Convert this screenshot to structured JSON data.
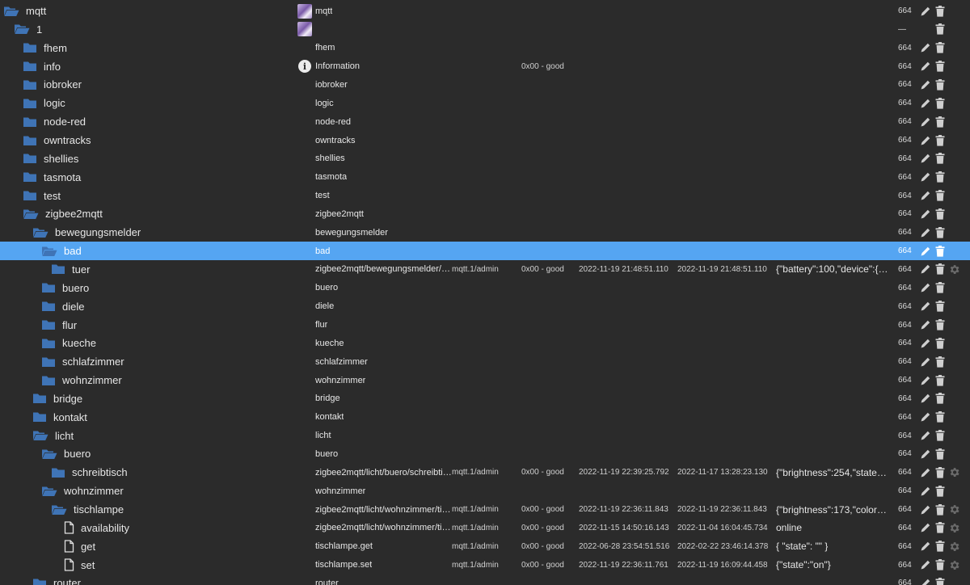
{
  "colors": {
    "background": "#2b2b2b",
    "selected_row": "#55a5f2",
    "folder_icon": "#3f74b6",
    "text": "#e6e6e6",
    "icon_gray": "#cfcfcf"
  },
  "rows": [
    {
      "name": "mqtt",
      "level": 0,
      "type": "folder-open",
      "display": "mqtt",
      "disp_icon": "logo",
      "acl": "664"
    },
    {
      "name": "1",
      "level": 1,
      "type": "folder-open",
      "display": "",
      "disp_icon": "logo",
      "acl": "—",
      "no_edit": true
    },
    {
      "name": "fhem",
      "level": 2,
      "type": "folder",
      "display": "fhem",
      "acl": "664"
    },
    {
      "name": "info",
      "level": 2,
      "type": "folder",
      "display": "Information",
      "disp_icon": "info",
      "quality": "0x00 - good",
      "acl": "664"
    },
    {
      "name": "iobroker",
      "level": 2,
      "type": "folder",
      "display": "iobroker",
      "acl": "664"
    },
    {
      "name": "logic",
      "level": 2,
      "type": "folder",
      "display": "logic",
      "acl": "664"
    },
    {
      "name": "node-red",
      "level": 2,
      "type": "folder",
      "display": "node-red",
      "acl": "664"
    },
    {
      "name": "owntracks",
      "level": 2,
      "type": "folder",
      "display": "owntracks",
      "acl": "664"
    },
    {
      "name": "shellies",
      "level": 2,
      "type": "folder",
      "display": "shellies",
      "acl": "664"
    },
    {
      "name": "tasmota",
      "level": 2,
      "type": "folder",
      "display": "tasmota",
      "acl": "664"
    },
    {
      "name": "test",
      "level": 2,
      "type": "folder",
      "display": "test",
      "acl": "664"
    },
    {
      "name": "zigbee2mqtt",
      "level": 2,
      "type": "folder-open",
      "display": "zigbee2mqtt",
      "acl": "664"
    },
    {
      "name": "bewegungsmelder",
      "level": 3,
      "type": "folder-open",
      "display": "bewegungsmelder",
      "acl": "664"
    },
    {
      "name": "bad",
      "level": 4,
      "type": "folder-open",
      "display": "bad",
      "acl": "664",
      "selected": true
    },
    {
      "name": "tuer",
      "level": 5,
      "type": "folder",
      "display": "zigbee2mqtt/bewegungsmelder/ba...",
      "from": "mqtt.1/admin",
      "quality": "0x00 - good",
      "ts": "2022-11-19 21:48:51.110",
      "lc": "2022-11-19 21:48:51.110",
      "value": "{\"battery\":100,\"device\":{\"a...",
      "acl": "664",
      "gear": true
    },
    {
      "name": "buero",
      "level": 4,
      "type": "folder",
      "display": "buero",
      "acl": "664"
    },
    {
      "name": "diele",
      "level": 4,
      "type": "folder",
      "display": "diele",
      "acl": "664"
    },
    {
      "name": "flur",
      "level": 4,
      "type": "folder",
      "display": "flur",
      "acl": "664"
    },
    {
      "name": "kueche",
      "level": 4,
      "type": "folder",
      "display": "kueche",
      "acl": "664"
    },
    {
      "name": "schlafzimmer",
      "level": 4,
      "type": "folder",
      "display": "schlafzimmer",
      "acl": "664"
    },
    {
      "name": "wohnzimmer",
      "level": 4,
      "type": "folder",
      "display": "wohnzimmer",
      "acl": "664"
    },
    {
      "name": "bridge",
      "level": 3,
      "type": "folder",
      "display": "bridge",
      "acl": "664"
    },
    {
      "name": "kontakt",
      "level": 3,
      "type": "folder",
      "display": "kontakt",
      "acl": "664"
    },
    {
      "name": "licht",
      "level": 3,
      "type": "folder-open",
      "display": "licht",
      "acl": "664"
    },
    {
      "name": "buero",
      "level": 4,
      "type": "folder-open",
      "display": "buero",
      "acl": "664"
    },
    {
      "name": "schreibtisch",
      "level": 5,
      "type": "folder",
      "display": "zigbee2mqtt/licht/buero/schreibtisch",
      "from": "mqtt.1/admin",
      "quality": "0x00 - good",
      "ts": "2022-11-19 22:39:25.792",
      "lc": "2022-11-17 13:28:23.130",
      "value": "{\"brightness\":254,\"state\":\"...",
      "acl": "664",
      "gear": true
    },
    {
      "name": "wohnzimmer",
      "level": 4,
      "type": "folder-open",
      "display": "wohnzimmer",
      "acl": "664"
    },
    {
      "name": "tischlampe",
      "level": 5,
      "type": "folder-open",
      "display": "zigbee2mqtt/licht/wohnzimmer/tisc...",
      "from": "mqtt.1/admin",
      "quality": "0x00 - good",
      "ts": "2022-11-19 22:36:11.843",
      "lc": "2022-11-19 22:36:11.843",
      "value": "{\"brightness\":173,\"color_m...",
      "acl": "664",
      "gear": true
    },
    {
      "name": "availability",
      "level": 6,
      "type": "file",
      "display": "zigbee2mqtt/licht/wohnzimmer/tisc...",
      "from": "mqtt.1/admin",
      "quality": "0x00 - good",
      "ts": "2022-11-15 14:50:16.143",
      "lc": "2022-11-04 16:04:45.734",
      "value": "online",
      "acl": "664",
      "gear": true
    },
    {
      "name": "get",
      "level": 6,
      "type": "file",
      "display": "tischlampe.get",
      "from": "mqtt.1/admin",
      "quality": "0x00 - good",
      "ts": "2022-06-28 23:54:51.516",
      "lc": "2022-02-22 23:46:14.378",
      "value": "{ \"state\": \"\" }",
      "acl": "664",
      "gear": true
    },
    {
      "name": "set",
      "level": 6,
      "type": "file",
      "display": "tischlampe.set",
      "from": "mqtt.1/admin",
      "quality": "0x00 - good",
      "ts": "2022-11-19 22:36:11.761",
      "lc": "2022-11-19 16:09:44.458",
      "value": "{\"state\":\"on\"}",
      "acl": "664",
      "gear": true
    },
    {
      "name": "router",
      "level": 3,
      "type": "folder",
      "display": "router",
      "acl": "664"
    }
  ]
}
